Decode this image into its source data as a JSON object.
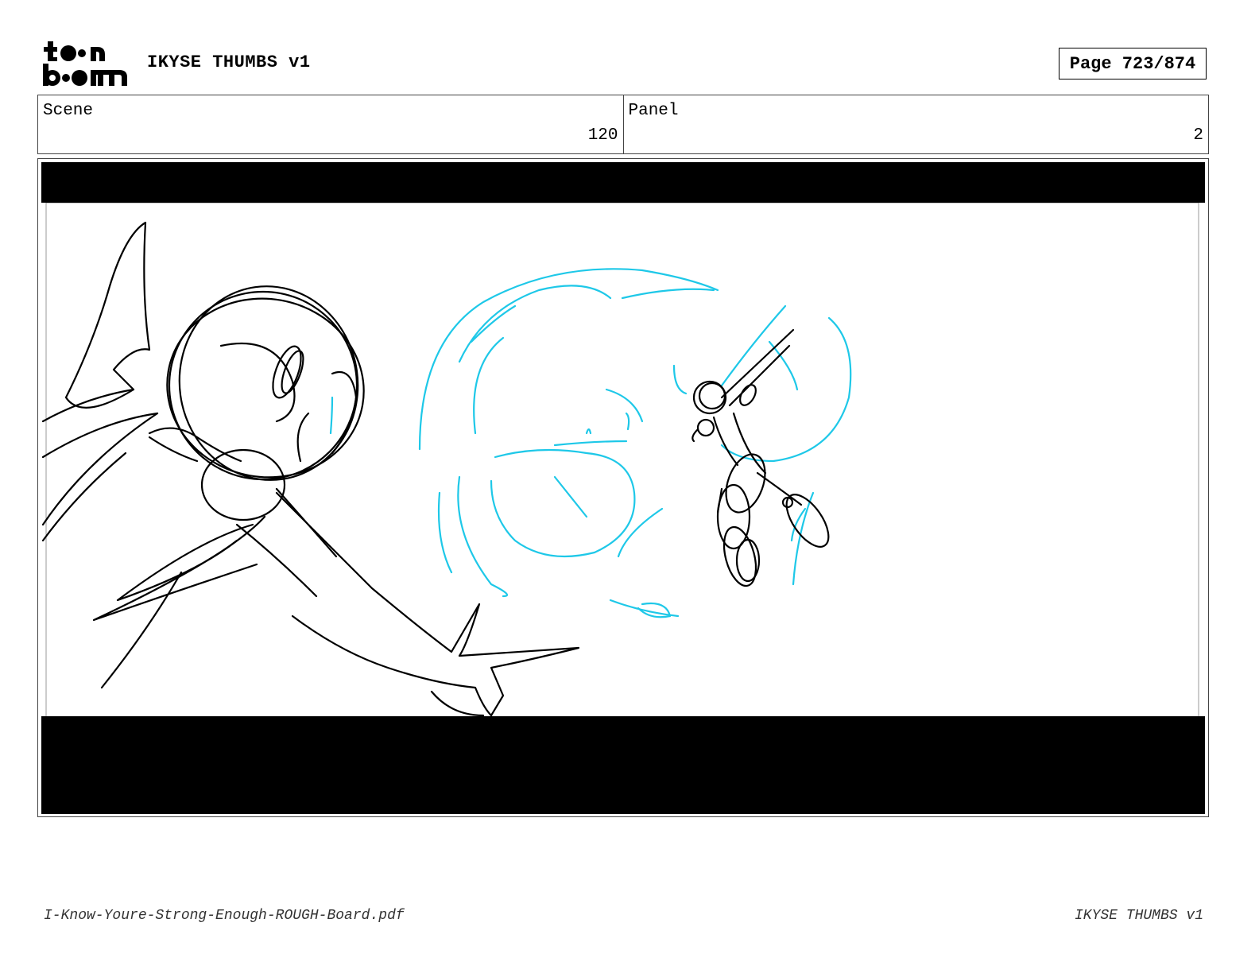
{
  "header": {
    "logo_icon": "toon-boom-logo",
    "logo_text": "toon boom",
    "title": "IKYSE THUMBS v1",
    "page_label": "Page 723/874"
  },
  "info": {
    "scene_label": "Scene",
    "scene_value": "120",
    "panel_label": "Panel",
    "panel_value": "2"
  },
  "panel": {
    "image_icon": "storyboard-sketch-image",
    "sketch_colors": {
      "line": "#000000",
      "guide": "#1ec8e8",
      "letterbox": "#000000"
    }
  },
  "footer": {
    "filename": "I-Know-Youre-Strong-Enough-ROUGH-Board.pdf",
    "title": "IKYSE THUMBS v1"
  }
}
